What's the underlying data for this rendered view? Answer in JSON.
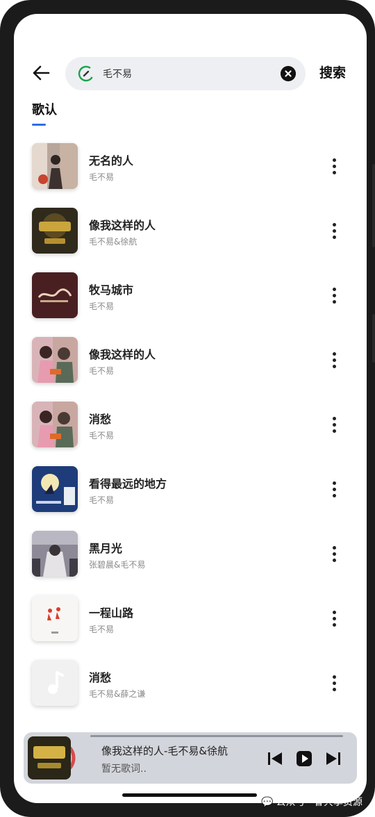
{
  "search": {
    "query": "毛不易",
    "button_label": "搜索"
  },
  "tabs": [
    {
      "label": "歌认"
    }
  ],
  "songs": [
    {
      "title": "无名的人",
      "artist": "毛不易",
      "cover": "cover-1"
    },
    {
      "title": "像我这样的人",
      "artist": "毛不易&徐航",
      "cover": "cover-2"
    },
    {
      "title": "牧马城市",
      "artist": "毛不易",
      "cover": "cover-3"
    },
    {
      "title": "像我这样的人",
      "artist": "毛不易",
      "cover": "cover-4"
    },
    {
      "title": "消愁",
      "artist": "毛不易",
      "cover": "cover-4"
    },
    {
      "title": "看得最远的地方",
      "artist": "毛不易",
      "cover": "cover-5"
    },
    {
      "title": "黑月光",
      "artist": "张碧晨&毛不易",
      "cover": "cover-6"
    },
    {
      "title": "一程山路",
      "artist": "毛不易",
      "cover": "cover-7"
    },
    {
      "title": "消愁",
      "artist": "毛不易&薛之谦",
      "cover": "cover-8"
    }
  ],
  "player": {
    "now_playing": "像我这样的人-毛不易&徐航",
    "lyric": "暂无歌词..",
    "progress": 0.0
  },
  "watermark": {
    "platform": "公众号",
    "separator": "·",
    "account": "睿共享资源"
  },
  "colors": {
    "accent": "#2f6fe0",
    "player_bg": "#d3d5dc",
    "search_bg": "#eeeff2"
  }
}
